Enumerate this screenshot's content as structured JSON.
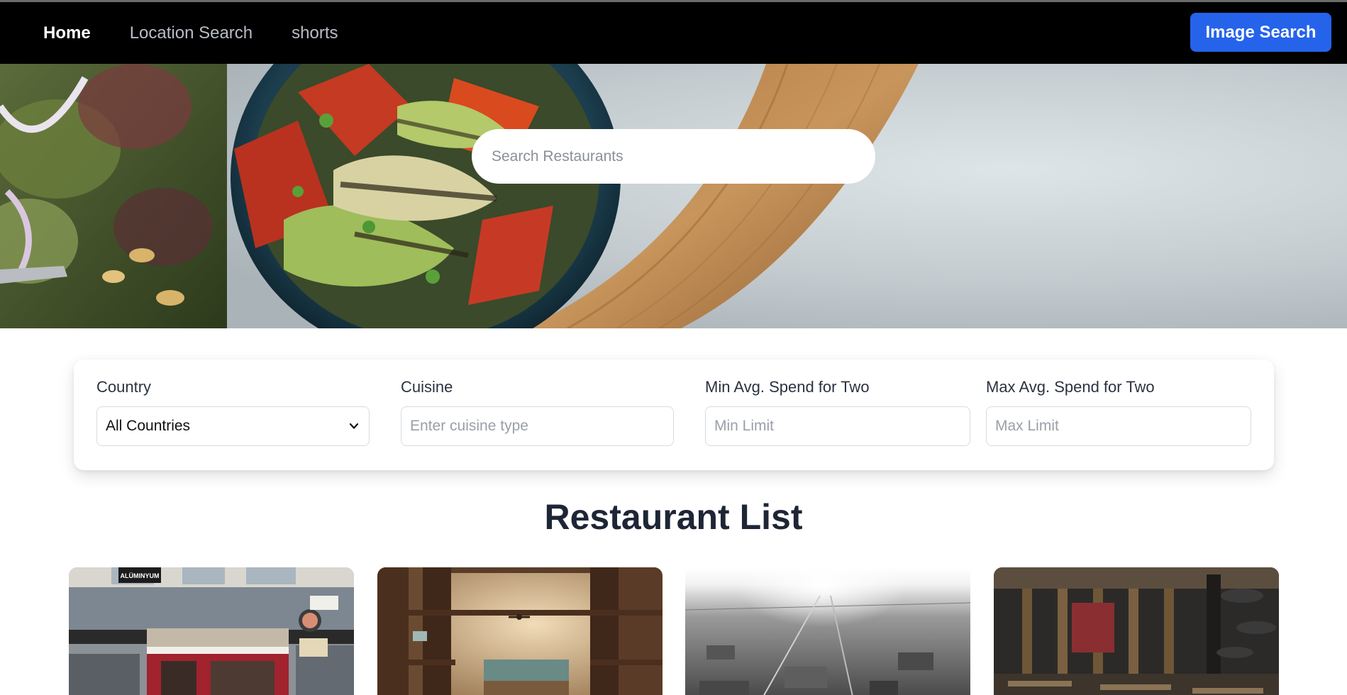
{
  "nav": {
    "links": [
      {
        "label": "Home",
        "active": true
      },
      {
        "label": "Location Search",
        "active": false
      },
      {
        "label": "shorts",
        "active": false
      }
    ],
    "image_search_label": "Image Search"
  },
  "hero": {
    "search_placeholder": "Search Restaurants"
  },
  "filters": {
    "country": {
      "label": "Country",
      "selected": "All Countries"
    },
    "cuisine": {
      "label": "Cuisine",
      "placeholder": "Enter cuisine type"
    },
    "min_spend": {
      "label": "Min Avg. Spend for Two",
      "placeholder": "Min Limit"
    },
    "max_spend": {
      "label": "Max Avg. Spend for Two",
      "placeholder": "Max Limit"
    }
  },
  "restaurant_list": {
    "title": "Restaurant List",
    "cards": [
      {
        "image_alt": "storefront-photo",
        "sign_text": "ALÜMINYUM"
      },
      {
        "image_alt": "cafe-interior-photo"
      },
      {
        "image_alt": "aerial-city-photo"
      },
      {
        "image_alt": "dining-room-photo"
      }
    ]
  },
  "colors": {
    "nav_bg": "#000000",
    "accent": "#2563eb",
    "title": "#1e2636"
  }
}
